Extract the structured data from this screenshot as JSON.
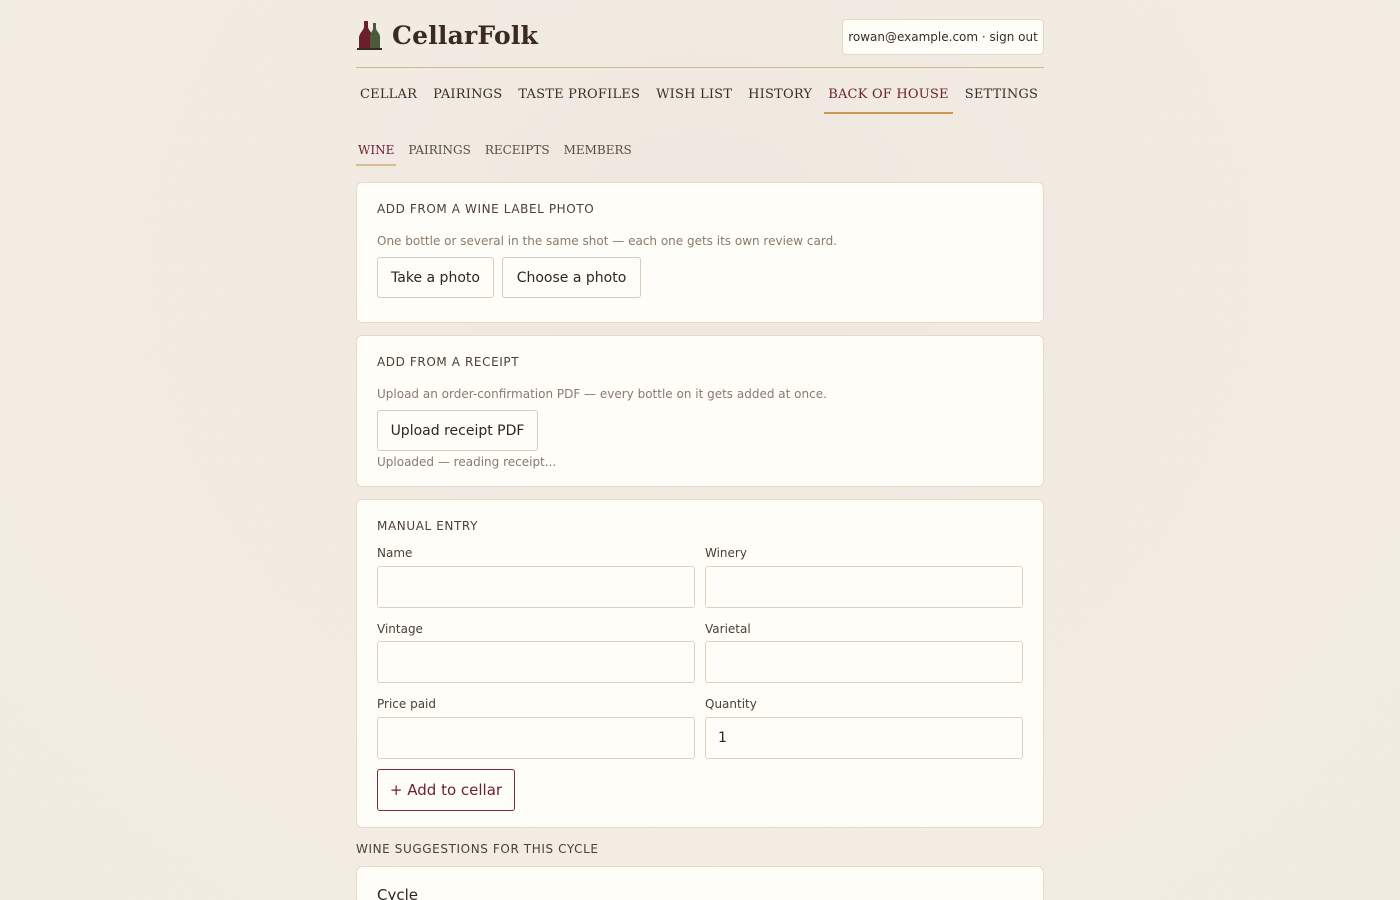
{
  "brand": {
    "name": "CellarFolk",
    "logo_icon": "wine-bottles-icon"
  },
  "user": {
    "label": "rowan@example.com · sign out"
  },
  "main_nav": [
    {
      "label": "CELLAR",
      "active": false
    },
    {
      "label": "PAIRINGS",
      "active": false
    },
    {
      "label": "TASTE PROFILES",
      "active": false
    },
    {
      "label": "WISH LIST",
      "active": false
    },
    {
      "label": "HISTORY",
      "active": false
    },
    {
      "label": "BACK OF HOUSE",
      "active": true
    },
    {
      "label": "SETTINGS",
      "active": false
    }
  ],
  "sub_nav": [
    {
      "label": "WINE",
      "active": true
    },
    {
      "label": "PAIRINGS",
      "active": false
    },
    {
      "label": "RECEIPTS",
      "active": false
    },
    {
      "label": "MEMBERS",
      "active": false
    }
  ],
  "label_photo": {
    "title": "ADD FROM A WINE LABEL PHOTO",
    "description": "One bottle or several in the same shot — each one gets its own review card.",
    "take_photo": "Take a photo",
    "choose_photo": "Choose a photo"
  },
  "receipt": {
    "title": "ADD FROM A RECEIPT",
    "description": "Upload an order-confirmation PDF — every bottle on it gets added at once.",
    "upload_button": "Upload receipt PDF",
    "status": "Uploaded — reading receipt..."
  },
  "manual_entry": {
    "title": "MANUAL ENTRY",
    "fields": {
      "name": {
        "label": "Name",
        "value": ""
      },
      "winery": {
        "label": "Winery",
        "value": ""
      },
      "vintage": {
        "label": "Vintage",
        "value": ""
      },
      "varietal": {
        "label": "Varietal",
        "value": ""
      },
      "price_paid": {
        "label": "Price paid",
        "value": ""
      },
      "quantity": {
        "label": "Quantity",
        "value": "1"
      }
    },
    "add_button": "+ Add to cellar"
  },
  "suggestions": {
    "heading": "WINE SUGGESTIONS FOR THIS CYCLE",
    "cycle_label": "Cycle"
  },
  "colors": {
    "accent_wine": "#6b1e2e",
    "accent_gold": "#c79a4f",
    "background": "#f3ede4",
    "card": "#fffdf7"
  }
}
